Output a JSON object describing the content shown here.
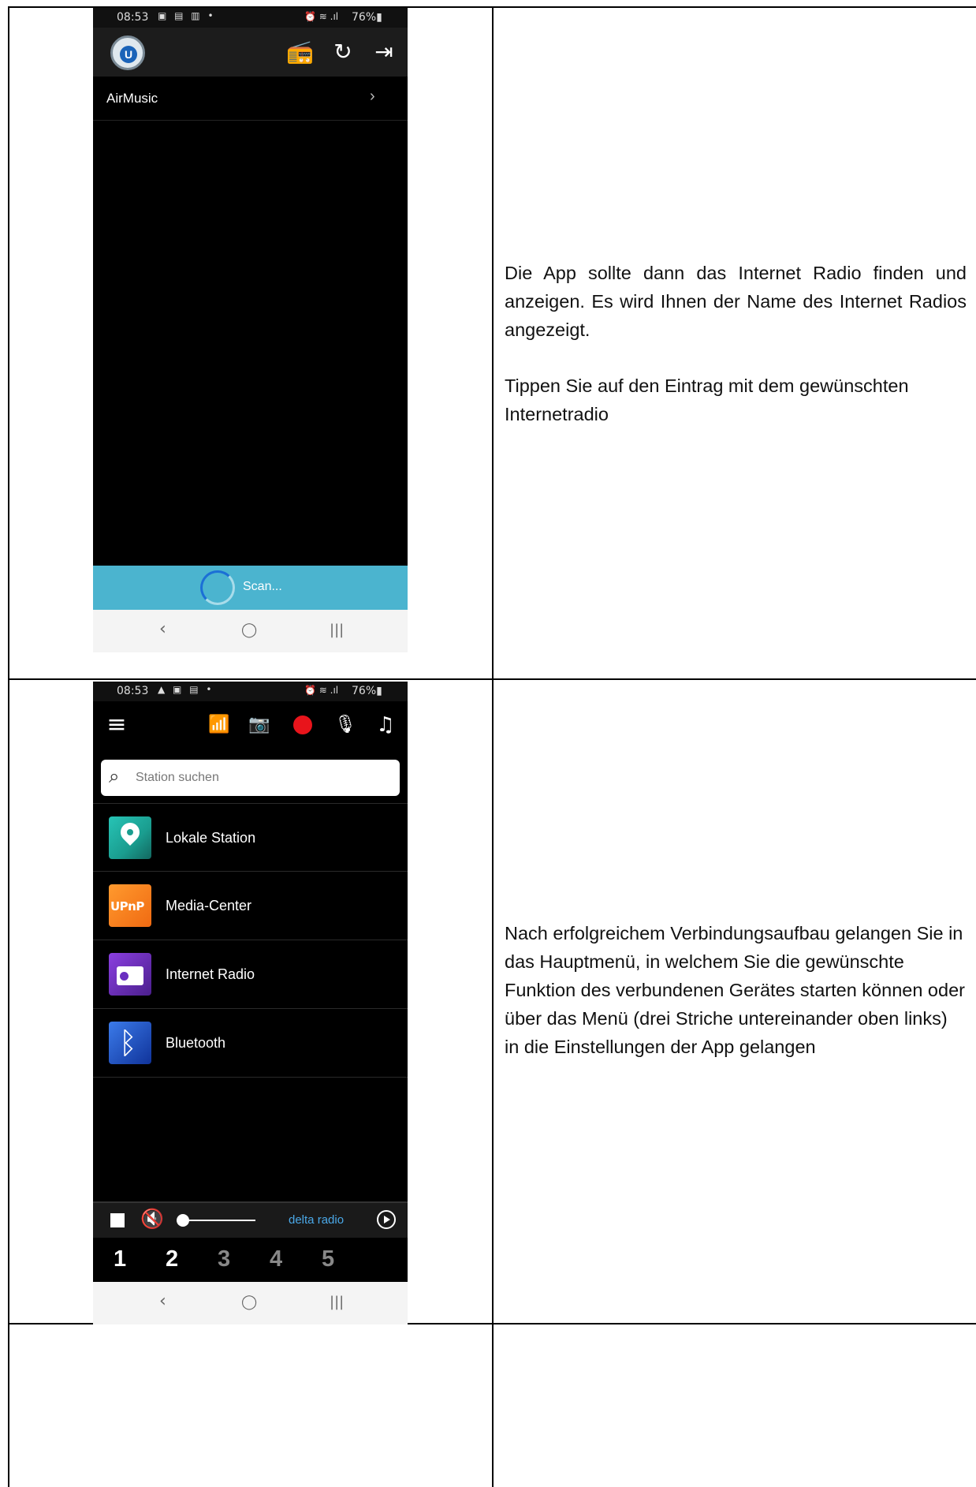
{
  "row1": {
    "phone": {
      "status_time": "08:53",
      "status_left_icons": "▣ ▤ ▥ •",
      "status_right_icons": "⏰ ≋ .ıl",
      "battery": "76%▮",
      "logo_letter": "U",
      "device_name": "AirMusic",
      "device_chevron": "›",
      "scan_label": "Scan..."
    },
    "paragraphs": [
      "Die App sollte dann das Internet Radio finden und anzeigen. Es wird Ihnen der Name des Internet Radios angezeigt.",
      "Tippen Sie auf den Eintrag mit dem gewünschten Internetradio"
    ]
  },
  "row2": {
    "phone": {
      "status_time": "08:53",
      "status_left_icons": "▲ ▣ ▤ •",
      "status_right_icons": "⏰ ≋ .ıl",
      "battery": "76%▮",
      "search_placeholder": "Station suchen",
      "menu_items": [
        {
          "label": "Lokale Station",
          "icon": "location-pin-icon"
        },
        {
          "label": "Media-Center",
          "icon": "upnp-icon",
          "icon_text": "UPnP"
        },
        {
          "label": "Internet Radio",
          "icon": "radio-icon"
        },
        {
          "label": "Bluetooth",
          "icon": "bluetooth-icon"
        }
      ],
      "now_playing": "delta radio",
      "presets": [
        "1",
        "2",
        "3",
        "4",
        "5"
      ],
      "preset_colors": [
        "#ffffff",
        "#ffffff",
        "#888888",
        "#888888",
        "#888888"
      ]
    },
    "paragraph": "Nach erfolgreichem Verbindungsaufbau gelangen Sie in das Hauptmenü, in welchem Sie die gewünschte Funktion des verbundenen Gerätes starten können oder über das Menü (drei Striche untereinander oben links) in die Einstellungen der App gelangen"
  },
  "nav": {
    "back": "‹",
    "home": "◯",
    "recents": "|||"
  },
  "icons": {
    "speaker_wifi": "📻",
    "refresh": "↻",
    "exit": "⇥",
    "menu": "≡",
    "remote": "📶",
    "camera": "📷",
    "mic": "🎙",
    "music_library": "♫",
    "search": "⌕",
    "mute": "🔇",
    "bluetooth": "ᛒ"
  }
}
